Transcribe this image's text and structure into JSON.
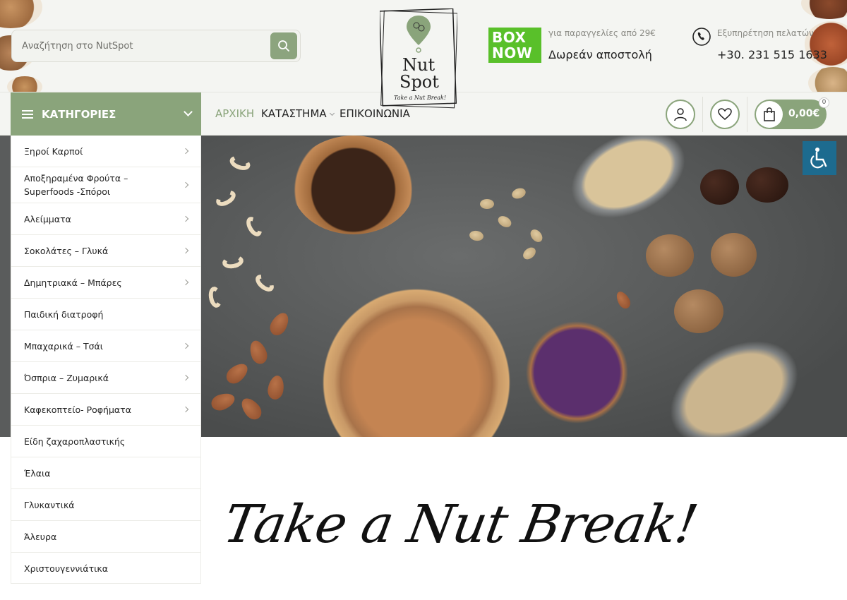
{
  "search": {
    "placeholder": "Αναζήτηση στο NutSpot"
  },
  "logo": {
    "line1": "Nut",
    "line2": "Spot",
    "tagline": "Take a Nut Break!"
  },
  "shipping": {
    "badge_line1": "BOX",
    "badge_line2": "NOW",
    "note": "για παραγγελίες από 29€",
    "title": "Δωρεάν αποστολή"
  },
  "support": {
    "note": "Εξυπηρέτηση πελατών",
    "phone": "+30. 231 515 1633"
  },
  "nav": {
    "categories_label": "ΚΑΤΗΓΟΡΙΕΣ",
    "home": "ΑΡΧΙΚΗ",
    "shop": "ΚΑΤΑΣΤΗΜΑ",
    "contact": "ΕΠΙΚΟΙΝΩΝΙΑ"
  },
  "cart": {
    "total": "0,00€",
    "count": "0"
  },
  "categories": [
    {
      "label": "Ξηροί Καρποί",
      "has_sub": true
    },
    {
      "label": "Αποξηραμένα Φρούτα – Superfoods -Σπόροι",
      "has_sub": true
    },
    {
      "label": "Αλείμματα",
      "has_sub": true
    },
    {
      "label": "Σοκολάτες – Γλυκά",
      "has_sub": true
    },
    {
      "label": "Δημητριακά – Μπάρες",
      "has_sub": true
    },
    {
      "label": "Παιδική διατροφή",
      "has_sub": false
    },
    {
      "label": "Μπαχαρικά – Τσάι",
      "has_sub": true
    },
    {
      "label": "Όσπρια – Ζυμαρικά",
      "has_sub": true
    },
    {
      "label": "Καφεκοπτείο- Ροφήματα",
      "has_sub": true
    },
    {
      "label": "Είδη ζαχαροπλαστικής",
      "has_sub": false
    },
    {
      "label": "Έλαια",
      "has_sub": false
    },
    {
      "label": "Γλυκαντικά",
      "has_sub": false
    },
    {
      "label": "Άλευρα",
      "has_sub": false
    },
    {
      "label": "Χριστουγεννιάτικα",
      "has_sub": false
    }
  ],
  "hero": {
    "slogan": "Take a Nut Break!"
  },
  "colors": {
    "accent": "#8aa47b",
    "boxnow": "#59c02a",
    "accessibility": "#1d6b8f"
  },
  "icons": [
    "search-icon",
    "phone-icon",
    "user-icon",
    "heart-icon",
    "bag-icon",
    "accessibility-icon",
    "menu-icon",
    "chevron-down-icon",
    "chevron-right-icon"
  ]
}
